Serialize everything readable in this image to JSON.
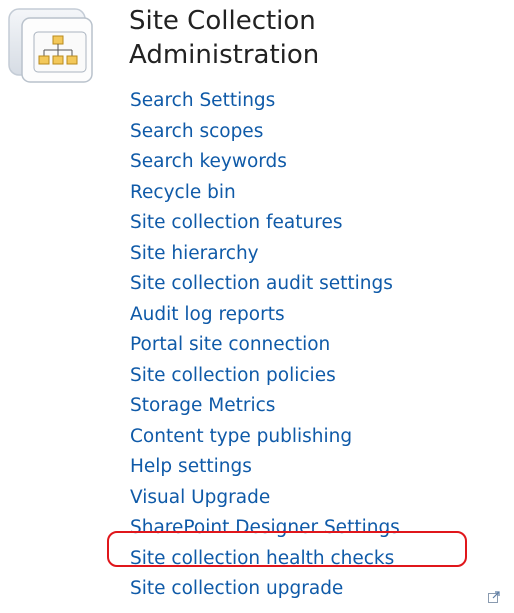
{
  "section": {
    "title_line1": "Site Collection",
    "title_line2": "Administration",
    "icon": "site-hierarchy-icon"
  },
  "links": [
    {
      "label": "Search Settings"
    },
    {
      "label": "Search scopes"
    },
    {
      "label": "Search keywords"
    },
    {
      "label": "Recycle bin"
    },
    {
      "label": "Site collection features"
    },
    {
      "label": "Site hierarchy"
    },
    {
      "label": "Site collection audit settings"
    },
    {
      "label": "Audit log reports"
    },
    {
      "label": "Portal site connection"
    },
    {
      "label": "Site collection policies"
    },
    {
      "label": "Storage Metrics"
    },
    {
      "label": "Content type publishing"
    },
    {
      "label": "Help settings"
    },
    {
      "label": "Visual Upgrade"
    },
    {
      "label": "SharePoint Designer Settings"
    },
    {
      "label": "Site collection health checks",
      "highlighted": true
    },
    {
      "label": "Site collection upgrade"
    }
  ],
  "colors": {
    "link": "#0f5aa8",
    "title": "#222222",
    "highlight_border": "#e0161b"
  },
  "footer_icon": "external-link-icon"
}
